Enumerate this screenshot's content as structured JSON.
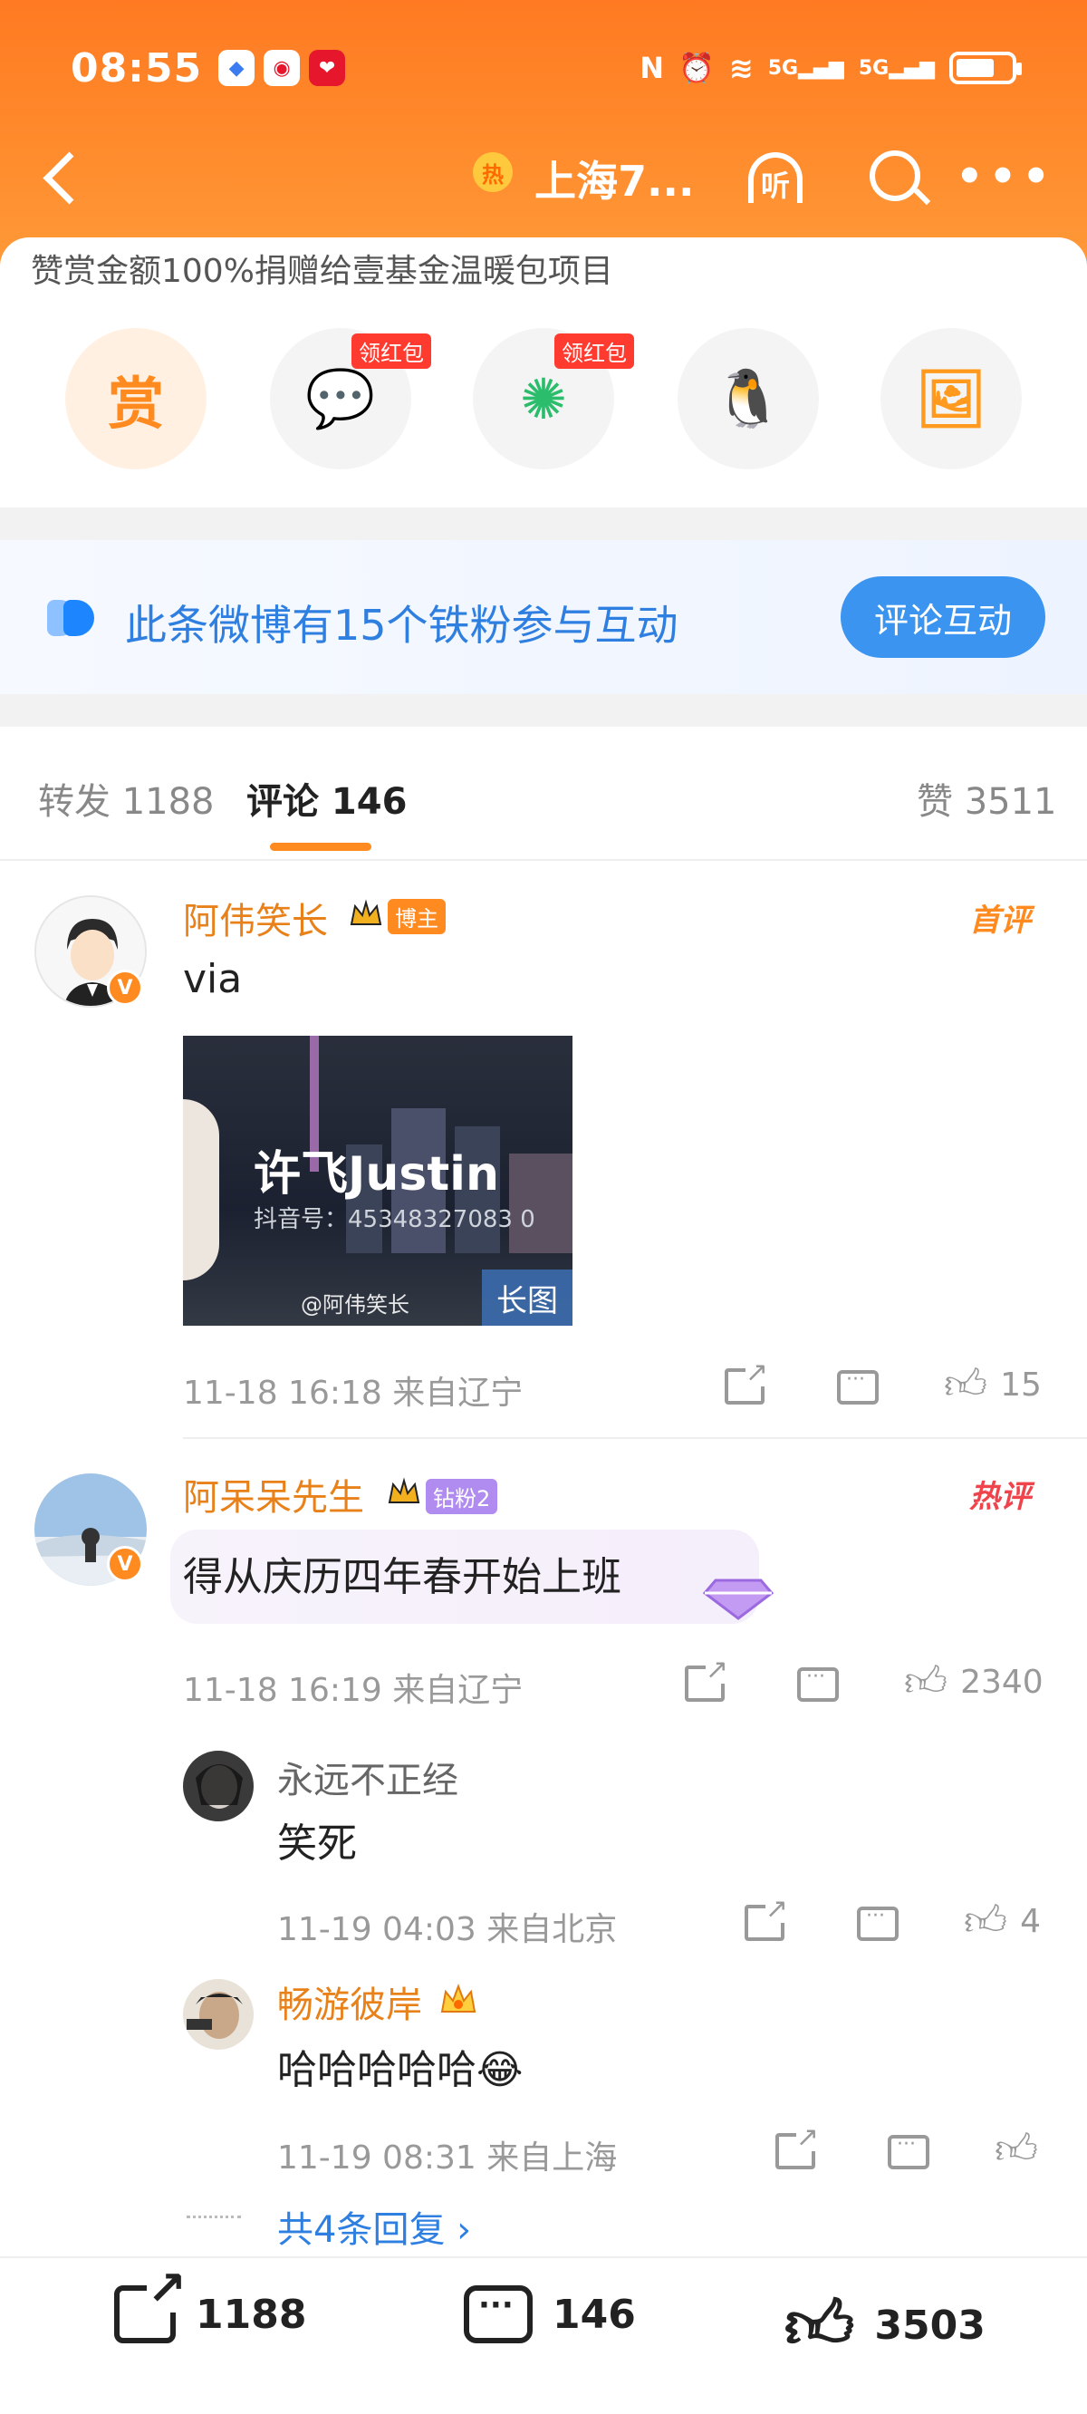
{
  "status_bar": {
    "time": "08:55",
    "signal_1": "5G",
    "signal_2": "5G",
    "icons": [
      "nfc-icon",
      "alarm-icon",
      "wifi-icon",
      "signal-icon",
      "battery-icon"
    ]
  },
  "nav": {
    "title": "上海7...",
    "hot_badge": "热",
    "listen_label": "听"
  },
  "reward": {
    "note": "赞赏金额100%捐赠给壹基金温暖包项目",
    "reward_glyph": "赏",
    "share_buttons": [
      {
        "name": "wechat",
        "tag": "领红包"
      },
      {
        "name": "moments",
        "tag": "领红包"
      },
      {
        "name": "qq",
        "tag": ""
      },
      {
        "name": "save-image",
        "tag": ""
      }
    ]
  },
  "fans_banner": {
    "text": "此条微博有15个铁粉参与互动",
    "button": "评论互动"
  },
  "tabs": {
    "repost": "转发 1188",
    "comments": "评论 146",
    "likes": "赞 3511"
  },
  "comments": [
    {
      "user": "阿伟笑长",
      "tag": "博主",
      "badge": "首评",
      "text": "via",
      "image": {
        "title": "许飞Justin",
        "subtitle": "抖音号：45348327083 0",
        "watermark": "@阿伟笑长",
        "long_tag": "长图"
      },
      "time": "11-18 16:18",
      "location": "来自辽宁",
      "likes": "15"
    },
    {
      "user": "阿呆呆先生",
      "tag": "钻粉2",
      "badge": "热评",
      "text": "得从庆历四年春开始上班",
      "time": "11-18 16:19",
      "location": "来自辽宁",
      "likes": "2340",
      "replies": [
        {
          "user": "永远不正经",
          "text": "笑死",
          "time": "11-19 04:03",
          "location": "来自北京",
          "likes": "4"
        },
        {
          "user": "畅游彼岸",
          "text": "哈哈哈哈哈😂",
          "time": "11-19 08:31",
          "location": "来自上海",
          "likes": ""
        }
      ],
      "more_replies": "共4条回复 ›"
    }
  ],
  "bottom_bar": {
    "reposts": "1188",
    "comments": "146",
    "likes": "3503"
  },
  "colors": {
    "header_orange": "#ff7a22",
    "accent_orange": "#ff8a1f",
    "link_blue": "#2f7fe0"
  }
}
